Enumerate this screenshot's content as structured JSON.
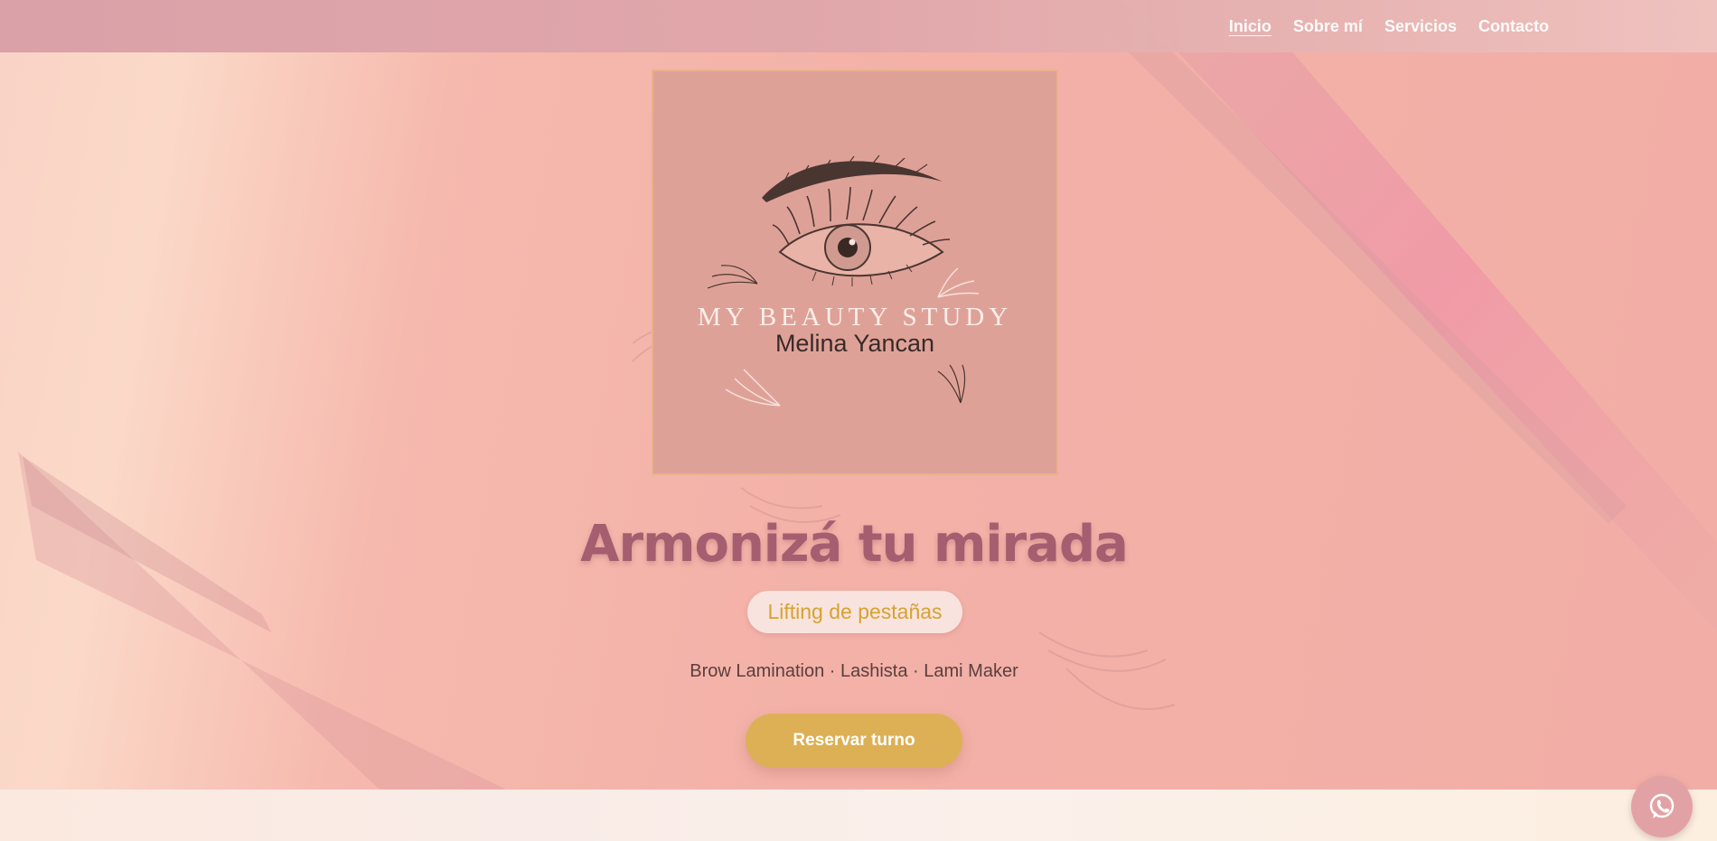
{
  "nav": {
    "items": [
      {
        "label": "Inicio",
        "active": true
      },
      {
        "label": "Sobre mí",
        "active": false
      },
      {
        "label": "Servicios",
        "active": false
      },
      {
        "label": "Contacto",
        "active": false
      }
    ]
  },
  "logo": {
    "brand": "MY BEAUTY STUDY",
    "name": "Melina Yancan"
  },
  "hero": {
    "title": "Armonizá tu mirada",
    "badge": "Lifting de pestañas",
    "subtitle": "Brow Lamination · Lashista · Lami Maker",
    "cta_label": "Reservar turno"
  },
  "fab": {
    "icon": "whatsapp-icon"
  },
  "colors": {
    "accent_gold": "#ddb055",
    "title_rose": "#a45e6f",
    "logo_bg": "#dea198",
    "nav_bg": "#d89ea6"
  }
}
